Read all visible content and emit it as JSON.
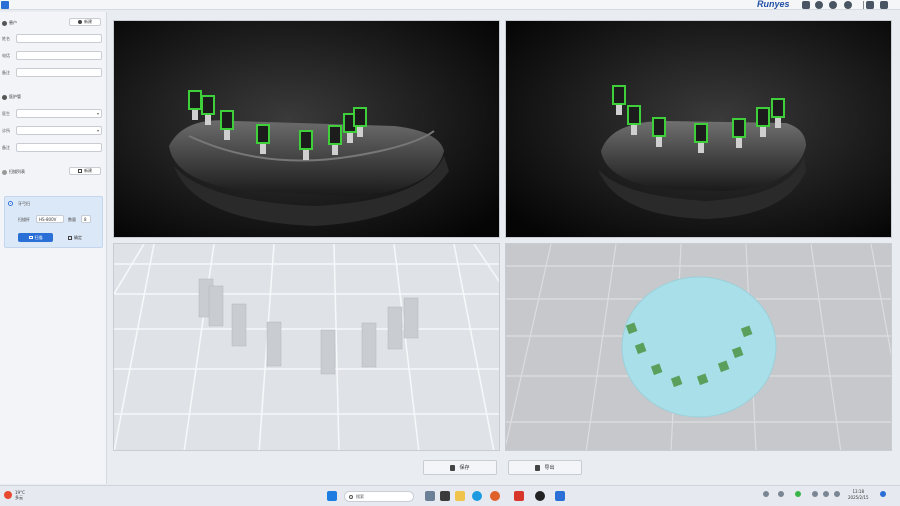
{
  "window": {
    "brand": "Runyes"
  },
  "sidebar": {
    "patient": {
      "title": "患户",
      "new_label": "新建"
    },
    "patient_fields": [
      {
        "label": "姓名",
        "value": ""
      },
      {
        "label": "电话",
        "value": ""
      },
      {
        "label": "备注",
        "value": ""
      }
    ],
    "doctor": {
      "title": "医护管"
    },
    "doctor_fields": [
      {
        "label": "医生",
        "value": ""
      },
      {
        "label": "诊所",
        "value": ""
      },
      {
        "label": "备注",
        "value": ""
      }
    ],
    "records": {
      "title": "扫描列表",
      "new_label": "新建"
    },
    "record_card": {
      "name": "牙弓扫",
      "range_label": "扫描杆",
      "range_value": "HS-800V",
      "count_label": "数量",
      "count_value": "8",
      "scan_label": "扫描",
      "confirm_label": "确定"
    }
  },
  "toolbar": {
    "save_label": "保存",
    "export_label": "导出"
  },
  "taskbar": {
    "weather_temp": "19°C",
    "weather_sub": "多云",
    "search_label": "搜索",
    "time": "13:18",
    "date": "2025/2/15"
  },
  "colors": {
    "accent": "#2a6fd6",
    "marker_green": "#3fcf3a",
    "disc": "#a9dfe8",
    "dot_green": "#5aa05c"
  },
  "icons": [
    "app-icon",
    "camera-icon",
    "gear-icon",
    "help-icon",
    "minimize-icon",
    "close-icon",
    "user-icon",
    "save-icon",
    "export-icon",
    "windows-icon",
    "search-icon"
  ]
}
